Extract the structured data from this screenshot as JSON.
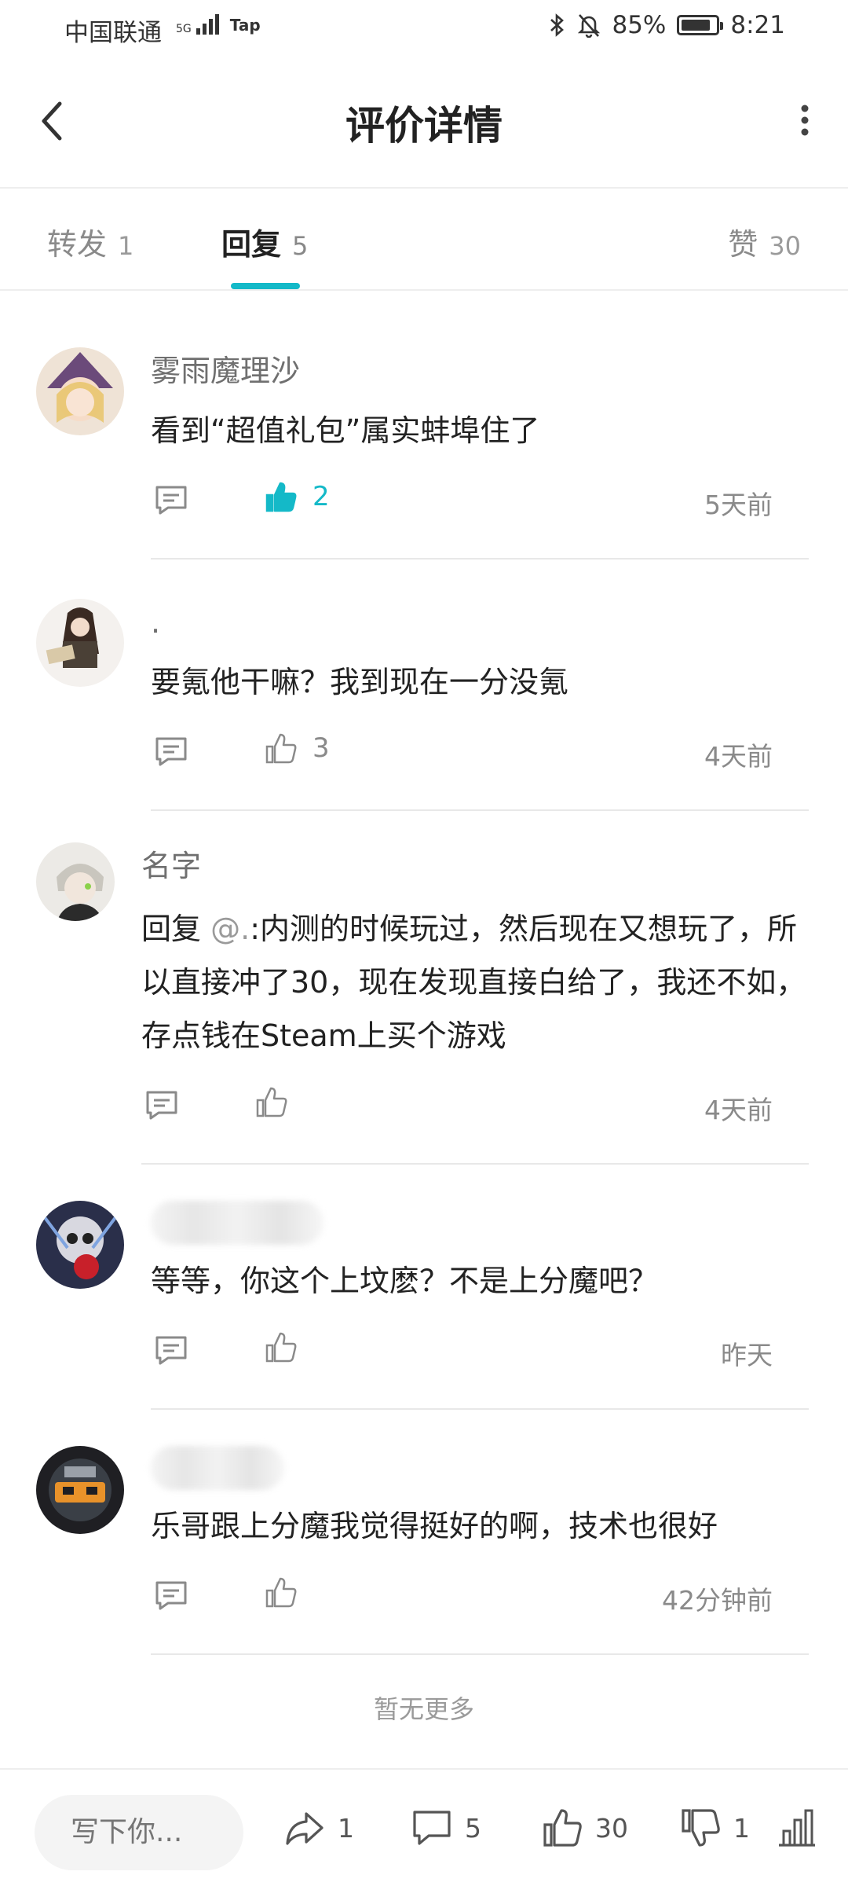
{
  "status_bar": {
    "carrier": "中国联通",
    "network": "5G",
    "app_tag": "Tap",
    "battery": "85%",
    "time": "8:21"
  },
  "app_bar": {
    "title": "评价详情"
  },
  "tabs": [
    {
      "label": "转发",
      "count": "1"
    },
    {
      "label": "回复",
      "count": "5"
    },
    {
      "label": "赞",
      "count": "30"
    }
  ],
  "comments": [
    {
      "name": "雾雨魔理沙",
      "text": "看到“超值礼包”属实蚌埠住了",
      "likes": "2",
      "liked": true,
      "time": "5天前"
    },
    {
      "name": ".",
      "text": "要氪他干嘛？我到现在一分没氪",
      "likes": "3",
      "liked": false,
      "time": "4天前"
    },
    {
      "name": "名字",
      "reply_prefix": "回复 ",
      "mention": "@.",
      "text": ":内测的时候玩过，然后现在又想玩了，所以直接冲了30，现在发现直接白给了，我还不如，存点钱在Steam上买个游戏",
      "likes": "",
      "liked": false,
      "time": "4天前"
    },
    {
      "name": "",
      "text": "等等，你这个上坟麽？不是上分魔吧？",
      "likes": "",
      "liked": false,
      "time": "昨天"
    },
    {
      "name": "",
      "text": "乐哥跟上分魔我觉得挺好的啊，技术也很好",
      "likes": "",
      "liked": false,
      "time": "42分钟前"
    }
  ],
  "footer": {
    "no_more": "暂无更多"
  },
  "bottom_bar": {
    "input_placeholder": "写下你...",
    "share_count": "1",
    "comment_count": "5",
    "like_count": "30",
    "dislike_count": "1"
  },
  "colors": {
    "accent": "#14b9c8",
    "text_primary": "#222222",
    "text_secondary": "#8a8a8a"
  }
}
